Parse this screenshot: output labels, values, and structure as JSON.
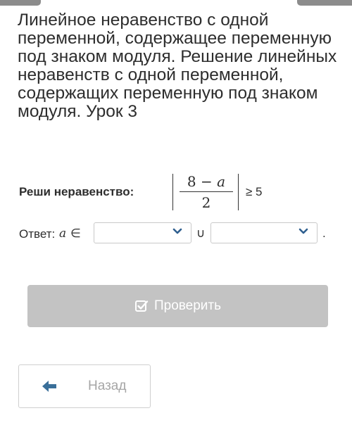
{
  "lesson": {
    "title": "Линейное неравенство с одной переменной, содержащее переменную под знаком модуля. Решение линейных неравенств с одной переменной, содержащих переменную под знаком модуля. Урок 3"
  },
  "task": {
    "label": "Реши неравенство:",
    "numerator_const": "8",
    "numerator_minus": " − ",
    "numerator_var": "a",
    "denominator": "2",
    "rhs": "≥ 5"
  },
  "answer": {
    "label": "Ответ:",
    "variable": "a",
    "in_symbol": "∈",
    "union_symbol": "∪",
    "end_dot": ".",
    "select_1_value": "",
    "select_2_value": ""
  },
  "buttons": {
    "check_label": "Проверить",
    "back_label": "Назад"
  },
  "icons": {
    "chevron": "chevron-down-icon",
    "check": "checkbox-check-icon",
    "back": "arrow-left-icon"
  },
  "colors": {
    "chevron": "#2f5f8f",
    "check_button_bg": "#c3c3c3",
    "back_arrow": "#3a6f99",
    "back_text": "#a6a6a6"
  }
}
